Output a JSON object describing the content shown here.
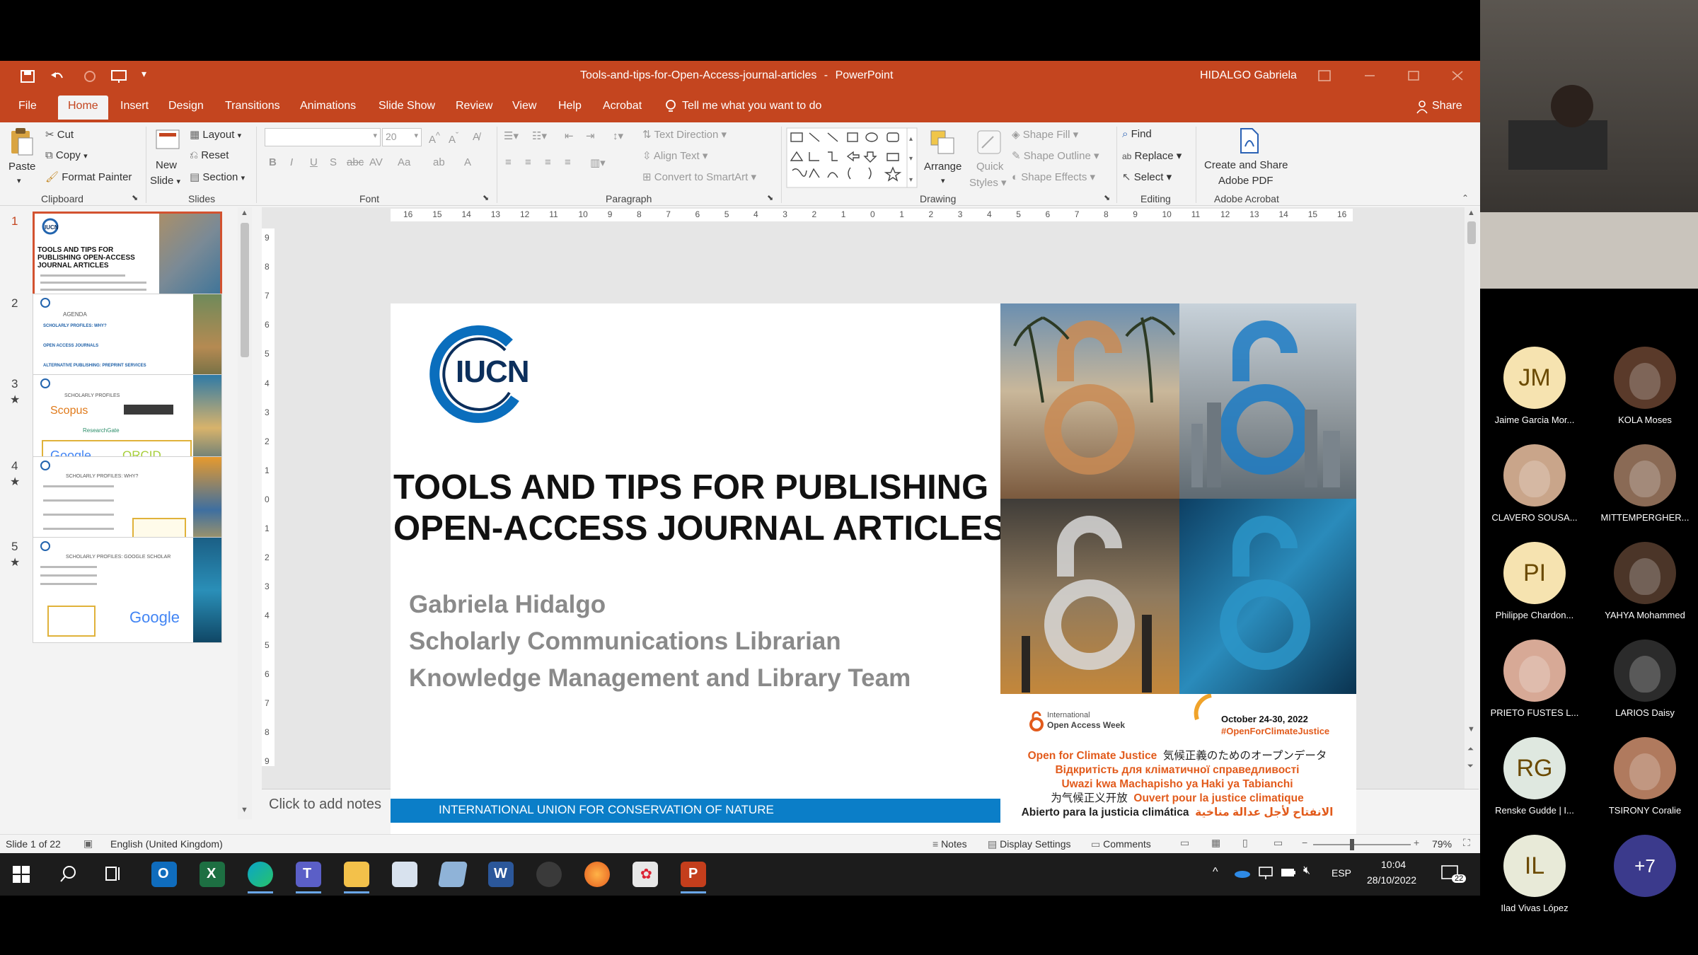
{
  "app": {
    "document_title": "Tools-and-tips-for-Open-Access-journal-articles",
    "app_name": "PowerPoint",
    "separator": "-",
    "user": "HIDALGO Gabriela"
  },
  "menu": [
    "File",
    "Home",
    "Insert",
    "Design",
    "Transitions",
    "Animations",
    "Slide Show",
    "Review",
    "View",
    "Help",
    "Acrobat"
  ],
  "tell_me": "Tell me what you want to do",
  "share": "Share",
  "ribbon": {
    "clipboard": {
      "paste": "Paste",
      "cut": "Cut",
      "copy": "Copy",
      "format_painter": "Format Painter",
      "label": "Clipboard"
    },
    "slides": {
      "new_slide_1": "New",
      "new_slide_2": "Slide",
      "layout": "Layout",
      "reset": "Reset",
      "section": "Section",
      "label": "Slides"
    },
    "font": {
      "size": "20",
      "label": "Font"
    },
    "paragraph": {
      "text_direction": "Text Direction",
      "align_text": "Align Text",
      "convert": "Convert to SmartArt",
      "label": "Paragraph"
    },
    "drawing": {
      "arrange": "Arrange",
      "quick_styles_1": "Quick",
      "quick_styles_2": "Styles",
      "shape_fill": "Shape Fill",
      "shape_outline": "Shape Outline",
      "shape_effects": "Shape Effects",
      "label": "Drawing"
    },
    "editing": {
      "find": "Find",
      "replace": "Replace",
      "select": "Select",
      "label": "Editing"
    },
    "acrobat": {
      "create_1": "Create and Share",
      "create_2": "Adobe PDF",
      "label": "Adobe Acrobat"
    }
  },
  "thumbnails": [
    {
      "num": "1",
      "starred": false
    },
    {
      "num": "2",
      "starred": false
    },
    {
      "num": "3",
      "starred": true
    },
    {
      "num": "4",
      "starred": true
    },
    {
      "num": "5",
      "starred": true
    }
  ],
  "thumb_text": {
    "t1_title": "TOOLS AND TIPS FOR PUBLISHING OPEN-ACCESS JOURNAL ARTICLES",
    "t2_title": "AGENDA",
    "t2_items": [
      "SCHOLARLY PROFILES: WHY?",
      "OPEN ACCESS JOURNALS",
      "ALTERNATIVE PUBLISHING: PREPRINT SERVICES"
    ],
    "t3_title": "SCHOLARLY PROFILES",
    "t3_logos": [
      "Scopus",
      "ResearchGate",
      "Google",
      "ORCID"
    ],
    "t4_title": "SCHOLARLY PROFILES: WHY?",
    "t5_title": "SCHOLARLY PROFILES: GOOGLE SCHOLAR",
    "t5_logo": "Google",
    "star": "★"
  },
  "slide": {
    "logo_text": "IUCN",
    "title_line1": "TOOLS AND TIPS FOR PUBLISHING",
    "title_line2": "OPEN-ACCESS JOURNAL ARTICLES",
    "author": "Gabriela Hidalgo",
    "role": "Scholarly Communications Librarian",
    "team": "Knowledge Management and Library Team",
    "footer": "INTERNATIONAL UNION FOR CONSERVATION OF NATURE",
    "oa_week_1": "International",
    "oa_week_2": "Open Access Week",
    "dates": "October 24-30, 2022",
    "hashtag": "#OpenForClimateJustice",
    "langs": [
      {
        "text": "Open for Climate Justice",
        "color": "#e25b1c"
      },
      {
        "text": "気候正義のためのオープンデータ",
        "color": "#222222"
      },
      {
        "text": "Відкритість для кліматичної справедливості",
        "color": "#e25b1c"
      },
      {
        "text": "Uwazi kwa Machapisho ya Haki ya Tabianchi",
        "color": "#e25b1c"
      },
      {
        "text": "为气候正义开放",
        "color": "#222222"
      },
      {
        "text": "Ouvert pour la justice climatique",
        "color": "#e25b1c"
      },
      {
        "text": "Abierto para la justicia climática",
        "color": "#222222"
      },
      {
        "text": "الانفتاح لأجل عدالة مناخية",
        "color": "#e25b1c"
      }
    ]
  },
  "ruler_h": [
    "16",
    "15",
    "14",
    "13",
    "12",
    "11",
    "10",
    "9",
    "8",
    "7",
    "6",
    "5",
    "4",
    "3",
    "2",
    "1",
    "0",
    "1",
    "2",
    "3",
    "4",
    "5",
    "6",
    "7",
    "8",
    "9",
    "10",
    "11",
    "12",
    "13",
    "14",
    "15",
    "16"
  ],
  "ruler_v": [
    "9",
    "8",
    "7",
    "6",
    "5",
    "4",
    "3",
    "2",
    "1",
    "0",
    "1",
    "2",
    "3",
    "4",
    "5",
    "6",
    "7",
    "8",
    "9"
  ],
  "notes_placeholder": "Click to add notes",
  "status": {
    "slide": "Slide 1 of 22",
    "language": "English (United Kingdom)",
    "notes": "Notes",
    "display": "Display Settings",
    "comments": "Comments",
    "zoom": "79%"
  },
  "taskbar": {
    "lang": "ESP",
    "time": "10:04",
    "date": "28/10/2022",
    "notif": "22"
  },
  "participants": [
    {
      "initials": "JM",
      "name": "Jaime Garcia Mor...",
      "color": "#f6e3b0",
      "photo": false
    },
    {
      "initials": "",
      "name": "KOLA Moses",
      "color": "#5a3a2a",
      "photo": true
    },
    {
      "initials": "",
      "name": "CLAVERO SOUSA...",
      "color": "#c9a58a",
      "photo": true
    },
    {
      "initials": "",
      "name": "MITTEMPERGHER...",
      "color": "#8a6a55",
      "photo": true
    },
    {
      "initials": "PI",
      "name": "Philippe Chardon...",
      "color": "#f6e3b0",
      "photo": false
    },
    {
      "initials": "",
      "name": "YAHYA Mohammed",
      "color": "#4b3528",
      "photo": true
    },
    {
      "initials": "",
      "name": "PRIETO FUSTES L...",
      "color": "#d7a996",
      "photo": true
    },
    {
      "initials": "",
      "name": "LARIOS Daisy",
      "color": "#2b2b2b",
      "photo": true
    },
    {
      "initials": "RG",
      "name": "Renske Gudde | I...",
      "color": "#dfe8e0",
      "photo": false
    },
    {
      "initials": "",
      "name": "TSIRONY Coralie",
      "color": "#b07a5e",
      "photo": true
    },
    {
      "initials": "IL",
      "name": "Ilad Vivas López",
      "color": "#e8ead8",
      "photo": false
    },
    {
      "initials": "+7",
      "name": "",
      "color": "#3b3a8c",
      "photo": false
    }
  ]
}
